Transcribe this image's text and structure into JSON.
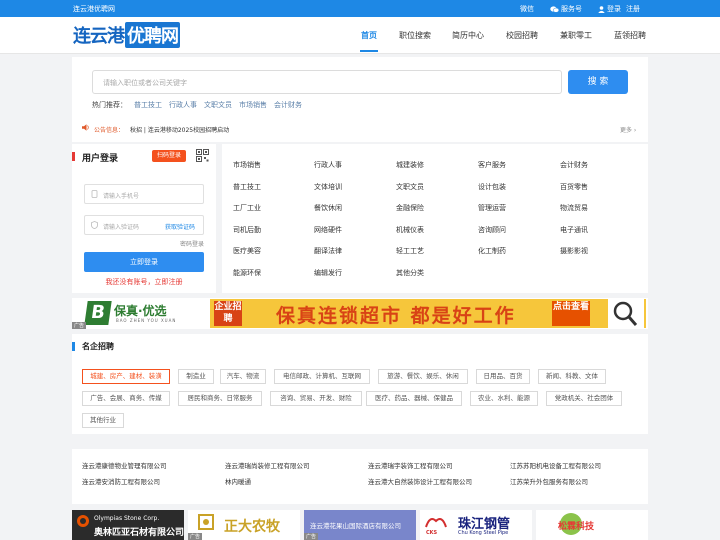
{
  "topbar": {
    "site": "连云港优聘网",
    "wechat": "微信",
    "service": "服务号",
    "login": "登录",
    "register": "注册"
  },
  "header": {
    "logo_a": "连云港",
    "logo_b": "优聘网",
    "nav": [
      "首页",
      "职位搜索",
      "简历中心",
      "校园招聘",
      "兼职零工",
      "蓝领招聘"
    ]
  },
  "search": {
    "placeholder": "请输入职位或者公司关键字",
    "button": "搜 索",
    "hot_label": "热门推荐：",
    "hot": [
      "普工技工",
      "行政人事",
      "文职文员",
      "市场销售",
      "会计财务"
    ]
  },
  "notice": {
    "label": "公告信息：",
    "text": "秋招 | 连云港移动2025校园招聘启动",
    "more": "更多 ›"
  },
  "login": {
    "title": "用户登录",
    "scan": "扫码登录",
    "phone_placeholder": "请输入手机号",
    "code_placeholder": "请输入验证码",
    "get_code": "获取验证码",
    "pwd_login": "密码登录",
    "button": "立即登录",
    "register": "我还没有账号，立即注册"
  },
  "categories": [
    [
      "市场销售",
      "行政人事",
      "城建装修",
      "客户服务",
      "会计财务"
    ],
    [
      "普工技工",
      "文体培训",
      "文职文员",
      "设计包装",
      "百货零售"
    ],
    [
      "工厂工业",
      "餐饮休闲",
      "金融保险",
      "管理运营",
      "物流贸易"
    ],
    [
      "司机后勤",
      "网络硬件",
      "机械仪表",
      "咨询顾问",
      "电子通讯"
    ],
    [
      "医疗美容",
      "翻译法律",
      "轻工工艺",
      "化工制药",
      "摄影影视"
    ],
    [
      "能源环保",
      "编辑发行",
      "其他分类"
    ]
  ],
  "banner": {
    "brand": "保真·优选",
    "brand_en": "BAO ZHEN YOU XUAN",
    "badge": "企业招聘",
    "slogan": "保真连锁超市 都是好工作",
    "click": "点击查看",
    "ad": "广告"
  },
  "famous": {
    "title": "名企招聘",
    "tags": [
      "城建、房产、建材、装潢",
      "制造业",
      "汽车、物流",
      "电信邮政、计算机、互联网",
      "旅游、餐饮、娱乐、休闲",
      "日用品、百货",
      "新闻、科教、文体",
      "广告、会展、商务、传媒",
      "居民和商务、日常服务",
      "咨询、贸易、开发、财险",
      "医疗、药品、器械、保健品",
      "农业、水利、能源",
      "党政机关、社会团体",
      "其他行业"
    ]
  },
  "companies": [
    "连云港康德物业管理有限公司",
    "连云港瑞尚装修工程有限公司",
    "连云港瑞宇装饰工程有限公司",
    "江苏苏阳机电设备工程有限公司",
    "连云港安消防工程有限公司",
    "林内暖通",
    "连云港大自然装饰设计工程有限公司",
    "江苏荣升外包服务有限公司"
  ],
  "ads": {
    "a1_en": "Olympias Stone Corp.",
    "a1_cn": "奥林匹亚石材有限公司",
    "a2": "正大农牧",
    "a3": "连云港花果山国际酒店有限公司",
    "a4_cn": "珠江钢管",
    "a4_en": "Chu Kong Steel Pipe",
    "a4_logo": "CKS",
    "a5": "松霖科技",
    "ad": "广告"
  },
  "colors": {
    "primary": "#1e88e5",
    "accent": "#f4511e"
  }
}
